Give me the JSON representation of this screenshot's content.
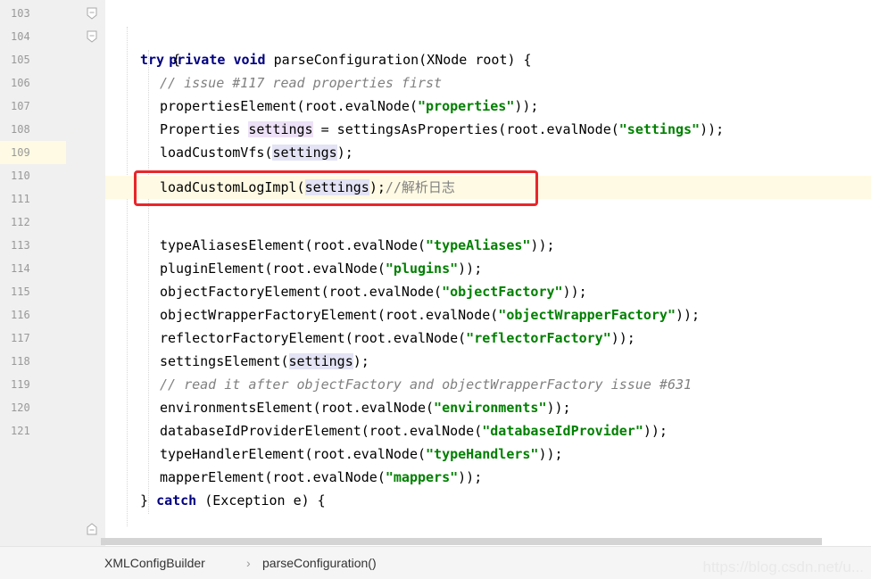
{
  "gutter": {
    "line_numbers": [
      "103",
      "104",
      "105",
      "106",
      "107",
      "108",
      "109",
      "110",
      "111",
      "112",
      "113",
      "114",
      "115",
      "116",
      "117",
      "118",
      "119",
      "120",
      "121"
    ]
  },
  "code": {
    "l103": {
      "kw1": "private",
      "kw2": "void",
      "rest": " parseConfiguration(XNode root) {"
    },
    "l104": {
      "kw": "try",
      "rest": " {"
    },
    "l105": {
      "comment": "// issue #117 read properties first"
    },
    "l106": {
      "pre": "propertiesElement(root.evalNode(",
      "str": "\"properties\"",
      "post": "));"
    },
    "l107": {
      "pre": "Properties ",
      "var": "settings",
      "mid": " = settingsAsProperties(root.evalNode(",
      "str": "\"settings\"",
      "post": "));"
    },
    "l108": {
      "pre": "loadCustomVfs(",
      "var": "settings",
      "post": ");"
    },
    "l109": {
      "pre": "loadCustomLogImpl(",
      "var": "settings",
      "post": ");",
      "comment": "//解析日志"
    },
    "l110": {
      "pre": "typeAliasesElement(root.evalNode(",
      "str": "\"typeAliases\"",
      "post": "));"
    },
    "l111": {
      "pre": "pluginElement(root.evalNode(",
      "str": "\"plugins\"",
      "post": "));"
    },
    "l112": {
      "pre": "objectFactoryElement(root.evalNode(",
      "str": "\"objectFactory\"",
      "post": "));"
    },
    "l113": {
      "pre": "objectWrapperFactoryElement(root.evalNode(",
      "str": "\"objectWrapperFactory\"",
      "post": "));"
    },
    "l114": {
      "pre": "reflectorFactoryElement(root.evalNode(",
      "str": "\"reflectorFactory\"",
      "post": "));"
    },
    "l115": {
      "pre": "settingsElement(",
      "var": "settings",
      "post": ");"
    },
    "l116": {
      "comment": "// read it after objectFactory and objectWrapperFactory issue #631"
    },
    "l117": {
      "pre": "environmentsElement(root.evalNode(",
      "str": "\"environments\"",
      "post": "));"
    },
    "l118": {
      "pre": "databaseIdProviderElement(root.evalNode(",
      "str": "\"databaseIdProvider\"",
      "post": "));"
    },
    "l119": {
      "pre": "typeHandlerElement(root.evalNode(",
      "str": "\"typeHandlers\"",
      "post": "));"
    },
    "l120": {
      "pre": "mapperElement(root.evalNode(",
      "str": "\"mappers\"",
      "post": "));"
    },
    "l121": {
      "pre": "} ",
      "kw": "catch",
      "rest": " (Exception e) {"
    }
  },
  "breadcrumb": {
    "class_name": "XMLConfigBuilder",
    "separator": "›",
    "method_name": "parseConfiguration()"
  },
  "watermark": "https://blog.csdn.net/u...",
  "colors": {
    "keyword": "#000080",
    "string": "#008000",
    "comment": "#808080",
    "highlight_box": "#e8262b",
    "current_line": "#fffae3"
  }
}
